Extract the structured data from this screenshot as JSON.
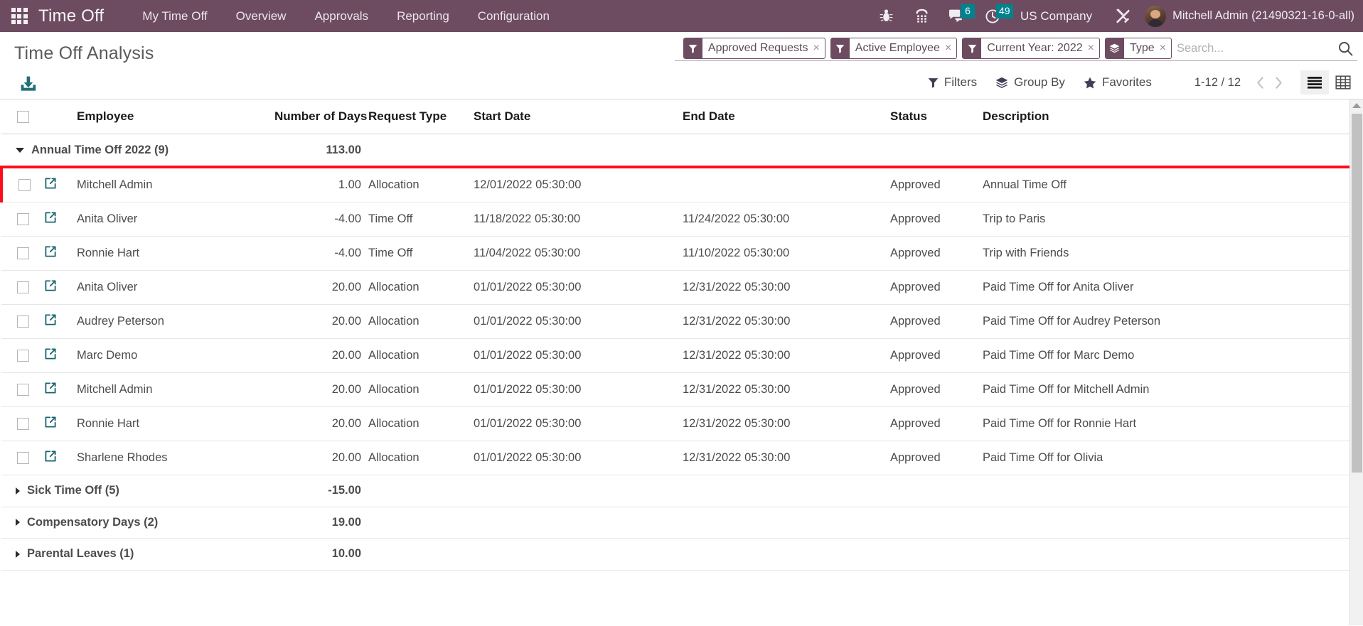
{
  "navbar": {
    "apps_icon": "apps-grid-icon",
    "brand": "Time Off",
    "menu_items": [
      {
        "label": "My Time Off"
      },
      {
        "label": "Overview"
      },
      {
        "label": "Approvals"
      },
      {
        "label": "Reporting"
      },
      {
        "label": "Configuration"
      }
    ],
    "system_icons": [
      {
        "name": "bug-icon",
        "badge": ""
      },
      {
        "name": "phone-keypad-icon",
        "badge": ""
      },
      {
        "name": "messages-icon",
        "badge": "6"
      },
      {
        "name": "activities-clock-icon",
        "badge": "49"
      }
    ],
    "company": "US Company",
    "settings_icon": "tools-icon",
    "user_name": "Mitchell Admin (21490321-16-0-all)",
    "accent_color": "#6d4c61",
    "badge_color": "#00838f"
  },
  "control_panel": {
    "title": "Time Off Analysis",
    "download_icon": "download-icon",
    "facets": [
      {
        "icon": "filter-icon",
        "label": "Approved Requests",
        "remove": "×"
      },
      {
        "icon": "filter-icon",
        "label": "Active Employee",
        "remove": "×"
      },
      {
        "icon": "filter-icon",
        "label": "Current Year: 2022",
        "remove": "×"
      },
      {
        "icon": "group-layers-icon",
        "label": "Type",
        "remove": "×"
      }
    ],
    "search_placeholder": "Search...",
    "search_value": "",
    "search_icon": "search-icon",
    "dropdowns": [
      {
        "icon": "filter-icon",
        "label": "Filters"
      },
      {
        "icon": "group-layers-icon",
        "label": "Group By"
      },
      {
        "icon": "star-icon",
        "label": "Favorites"
      }
    ],
    "pager": "1-12 / 12",
    "prev_icon": "chevron-left-icon",
    "next_icon": "chevron-right-icon",
    "views": [
      {
        "name": "list-view-button",
        "icon": "list-icon",
        "active": true
      },
      {
        "name": "pivot-view-button",
        "icon": "table-grid-icon",
        "active": false
      }
    ]
  },
  "list": {
    "columns": [
      "Employee",
      "Number of Days",
      "Request Type",
      "Start Date",
      "End Date",
      "Status",
      "Description"
    ],
    "groups": [
      {
        "label": "Annual Time Off 2022 (9)",
        "sum": "113.00",
        "expanded": true,
        "rows": [
          {
            "employee": "Mitchell Admin",
            "days": "1.00",
            "request_type": "Allocation",
            "start_date": "12/01/2022 05:30:00",
            "end_date": "",
            "status": "Approved",
            "description": "Annual Time Off",
            "highlighted": true
          },
          {
            "employee": "Anita Oliver",
            "days": "-4.00",
            "request_type": "Time Off",
            "start_date": "11/18/2022 05:30:00",
            "end_date": "11/24/2022 05:30:00",
            "status": "Approved",
            "description": "Trip to Paris",
            "highlighted": false
          },
          {
            "employee": "Ronnie Hart",
            "days": "-4.00",
            "request_type": "Time Off",
            "start_date": "11/04/2022 05:30:00",
            "end_date": "11/10/2022 05:30:00",
            "status": "Approved",
            "description": "Trip with Friends",
            "highlighted": false
          },
          {
            "employee": "Anita Oliver",
            "days": "20.00",
            "request_type": "Allocation",
            "start_date": "01/01/2022 05:30:00",
            "end_date": "12/31/2022 05:30:00",
            "status": "Approved",
            "description": "Paid Time Off for Anita Oliver",
            "highlighted": false
          },
          {
            "employee": "Audrey Peterson",
            "days": "20.00",
            "request_type": "Allocation",
            "start_date": "01/01/2022 05:30:00",
            "end_date": "12/31/2022 05:30:00",
            "status": "Approved",
            "description": "Paid Time Off for Audrey Peterson",
            "highlighted": false
          },
          {
            "employee": "Marc Demo",
            "days": "20.00",
            "request_type": "Allocation",
            "start_date": "01/01/2022 05:30:00",
            "end_date": "12/31/2022 05:30:00",
            "status": "Approved",
            "description": "Paid Time Off for Marc Demo",
            "highlighted": false
          },
          {
            "employee": "Mitchell Admin",
            "days": "20.00",
            "request_type": "Allocation",
            "start_date": "01/01/2022 05:30:00",
            "end_date": "12/31/2022 05:30:00",
            "status": "Approved",
            "description": "Paid Time Off for Mitchell Admin",
            "highlighted": false
          },
          {
            "employee": "Ronnie Hart",
            "days": "20.00",
            "request_type": "Allocation",
            "start_date": "01/01/2022 05:30:00",
            "end_date": "12/31/2022 05:30:00",
            "status": "Approved",
            "description": "Paid Time Off for Ronnie Hart",
            "highlighted": false
          },
          {
            "employee": "Sharlene Rhodes",
            "days": "20.00",
            "request_type": "Allocation",
            "start_date": "01/01/2022 05:30:00",
            "end_date": "12/31/2022 05:30:00",
            "status": "Approved",
            "description": "Paid Time Off for Olivia",
            "highlighted": false
          }
        ]
      },
      {
        "label": "Sick Time Off (5)",
        "sum": "-15.00",
        "expanded": false,
        "rows": []
      },
      {
        "label": "Compensatory Days (2)",
        "sum": "19.00",
        "expanded": false,
        "rows": []
      },
      {
        "label": "Parental Leaves (1)",
        "sum": "10.00",
        "expanded": false,
        "rows": []
      }
    ],
    "highlight_color": "#fc0d1b",
    "open_icon": "external-link-icon",
    "checkbox_icon": "checkbox-icon"
  }
}
